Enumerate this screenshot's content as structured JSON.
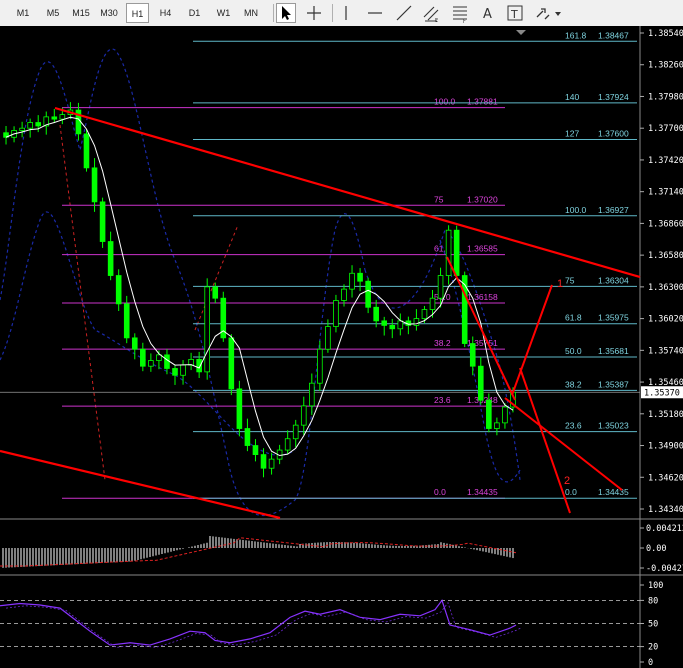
{
  "toolbar": {
    "timeframes": [
      "M1",
      "M5",
      "M15",
      "M30",
      "H1",
      "H4",
      "D1",
      "W1",
      "MN"
    ],
    "active_timeframe": "H1",
    "tools": [
      {
        "name": "cursor-icon",
        "active": true
      },
      {
        "name": "crosshair-icon",
        "active": false
      },
      {
        "name": "vertical-line-icon",
        "active": false
      },
      {
        "name": "horizontal-line-icon",
        "active": false
      },
      {
        "name": "trendline-icon",
        "active": false
      },
      {
        "name": "equidistant-channel-icon",
        "active": false
      },
      {
        "name": "fibonacci-retracement-icon",
        "active": false
      },
      {
        "name": "text-icon",
        "active": false
      },
      {
        "name": "text-label-icon",
        "active": false
      },
      {
        "name": "arrows-icon",
        "active": false
      }
    ]
  },
  "colors": {
    "candle": "#00ff00",
    "trendline": "#ff0000",
    "fib_magenta": "#cc33cc",
    "fib_teal": "#5fb8c8",
    "bollinger": "#1a2aa8",
    "ma": "#ffffff",
    "stoch": "#8833ff"
  },
  "chart_data": [
    {
      "type": "line",
      "panel": "price",
      "symbol_ticks": {
        "values": [
          "1.38540",
          "1.38260",
          "1.37980",
          "1.37700",
          "1.37420",
          "1.37140",
          "1.36860",
          "1.36580",
          "1.36300",
          "1.36020",
          "1.35740",
          "1.35460",
          "1.35180",
          "1.34900",
          "1.34620",
          "1.34340"
        ],
        "current_price": "1.35370"
      },
      "ylim": [
        1.3434,
        1.3854
      ],
      "close_series": [
        1.3762,
        1.3768,
        1.377,
        1.3775,
        1.3772,
        1.378,
        1.3778,
        1.3782,
        1.3786,
        1.3765,
        1.3735,
        1.3705,
        1.367,
        1.364,
        1.3615,
        1.3585,
        1.3575,
        1.356,
        1.3565,
        1.357,
        1.3558,
        1.3552,
        1.3561,
        1.3566,
        1.3555,
        1.363,
        1.362,
        1.3585,
        1.354,
        1.3505,
        1.349,
        1.3482,
        1.347,
        1.3478,
        1.3486,
        1.3496,
        1.3508,
        1.3525,
        1.3545,
        1.3575,
        1.3595,
        1.3618,
        1.3628,
        1.3642,
        1.3635,
        1.3612,
        1.36,
        1.3596,
        1.3593,
        1.36,
        1.3596,
        1.3602,
        1.361,
        1.362,
        1.364,
        1.368,
        1.364,
        1.358,
        1.356,
        1.353,
        1.3505,
        1.351,
        1.3524,
        1.3537
      ],
      "fibonacci": [
        {
          "level": "161.8",
          "price": "1.38467",
          "group": "teal"
        },
        {
          "level": "100.0",
          "price": "1.37881",
          "group": "magenta"
        },
        {
          "level": "140",
          "price": "1.37924",
          "group": "teal"
        },
        {
          "level": "127",
          "price": "1.37600",
          "group": "teal"
        },
        {
          "level": "75",
          "price": "1.37020",
          "group": "magenta"
        },
        {
          "level": "100.0",
          "price": "1.36927",
          "group": "teal"
        },
        {
          "level": "61.8",
          "price": "1.36585",
          "group": "magenta"
        },
        {
          "level": "75",
          "price": "1.36304",
          "group": "teal"
        },
        {
          "level": "50.0",
          "price": "1.36158",
          "group": "magenta"
        },
        {
          "level": "61.8",
          "price": "1.35975",
          "group": "teal"
        },
        {
          "level": "38.2",
          "price": "1.35751",
          "group": "magenta"
        },
        {
          "level": "50.0",
          "price": "1.35681",
          "group": "teal"
        },
        {
          "level": "38.2",
          "price": "1.35387",
          "group": "teal"
        },
        {
          "level": "23.6",
          "price": "1.35248",
          "group": "magenta"
        },
        {
          "level": "23.6",
          "price": "1.35023",
          "group": "teal"
        },
        {
          "level": "0.0",
          "price": "1.34435",
          "group": "magenta"
        },
        {
          "level": "0.0",
          "price": "1.34435",
          "group": "teal"
        }
      ],
      "annotations": [
        "1",
        "2"
      ]
    },
    {
      "type": "bar",
      "panel": "macd",
      "ticks": [
        "0.004212",
        "0.00",
        "-0.00427"
      ]
    },
    {
      "type": "line",
      "panel": "stochastic",
      "ticks": [
        "100",
        "80",
        "50",
        "20",
        "0"
      ],
      "levels": [
        80,
        50,
        20
      ]
    }
  ]
}
